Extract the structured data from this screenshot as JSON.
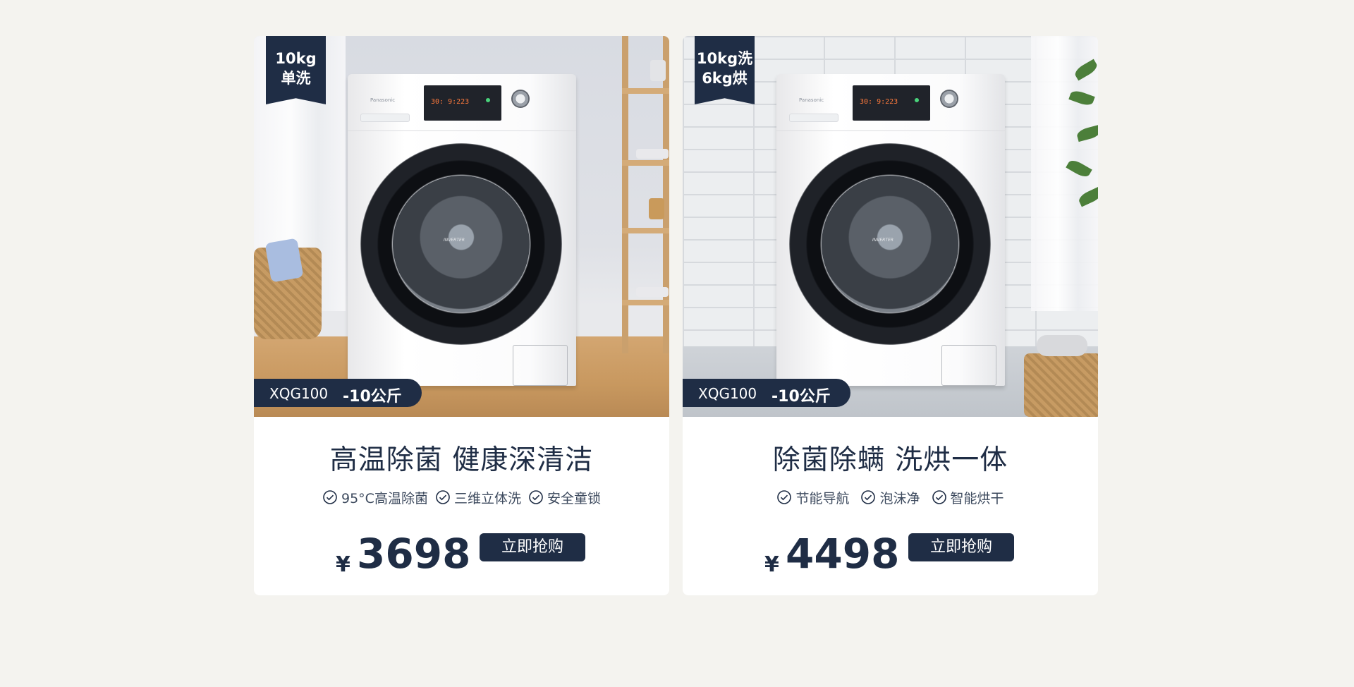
{
  "products": [
    {
      "ribbon": [
        "10kg",
        "单洗"
      ],
      "model_code": "XQG100",
      "model_capacity": "-10公斤",
      "washer_brand": "Panasonic",
      "washer_display": "30: 9:223",
      "drum_label": "INVERTER",
      "headline": "高温除菌  健康深清洁",
      "features": [
        "95°C高温除菌",
        "三维立体洗",
        "安全童锁"
      ],
      "currency": "¥",
      "price": "3698",
      "cta": "立即抢购"
    },
    {
      "ribbon": [
        "10kg洗",
        "6kg烘"
      ],
      "model_code": "XQG100",
      "model_capacity": "-10公斤",
      "washer_brand": "Panasonic",
      "washer_display": "30: 9:223",
      "drum_label": "INVERTER",
      "headline": "除菌除螨  洗烘一体",
      "features": [
        "节能导航",
        "泡沫净",
        "智能烘干"
      ],
      "currency": "¥",
      "price": "4498",
      "cta": "立即抢购"
    }
  ],
  "colors": {
    "page_bg": "#f4f3ef",
    "navy": "#1f2d45",
    "card_bg": "#ffffff"
  },
  "icons": {
    "feature": "check-circle-icon"
  }
}
